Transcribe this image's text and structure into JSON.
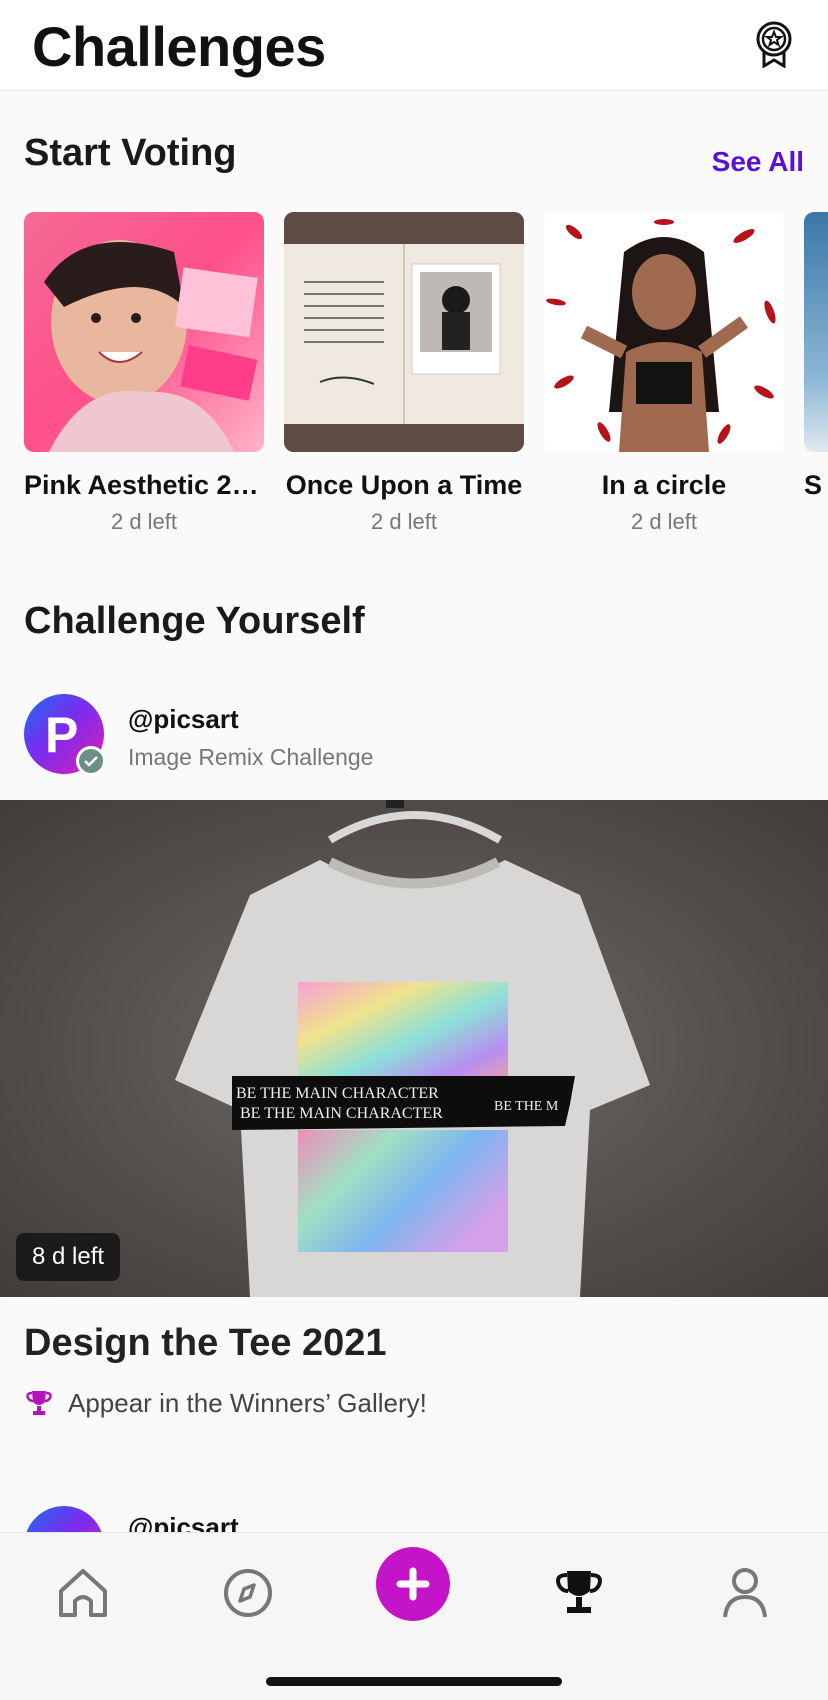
{
  "header": {
    "title": "Challenges",
    "badge_icon": "award-badge-icon"
  },
  "voting": {
    "title": "Start Voting",
    "see_all": "See All",
    "cards": [
      {
        "title": "Pink Aesthetic 20...",
        "time": "2 d left"
      },
      {
        "title": "Once Upon a Time",
        "time": "2 d left"
      },
      {
        "title": "In a circle",
        "time": "2 d left"
      },
      {
        "title": "S",
        "time": ""
      }
    ]
  },
  "challenge_yourself": {
    "title": "Challenge Yourself",
    "author": {
      "handle": "@picsart",
      "subtitle": "Image Remix Challenge",
      "avatar_letter": "P"
    },
    "feature": {
      "time_left": "8 d left",
      "title": "Design the Tee 2021",
      "reward": "Appear in the Winners’ Gallery!",
      "tee_text": [
        "BE THE MAIN CHARACTER",
        "BE THE MAIN CHARACTER",
        "BE THE M"
      ]
    },
    "next_author": {
      "handle": "@picsart"
    }
  },
  "nav": {
    "items": [
      "home-icon",
      "explore-compass-icon",
      "create-plus-icon",
      "challenges-trophy-icon",
      "profile-icon"
    ]
  },
  "colors": {
    "accent": "#5a10d6",
    "create": "#c414c8",
    "reward_icon": "#b515b8"
  }
}
